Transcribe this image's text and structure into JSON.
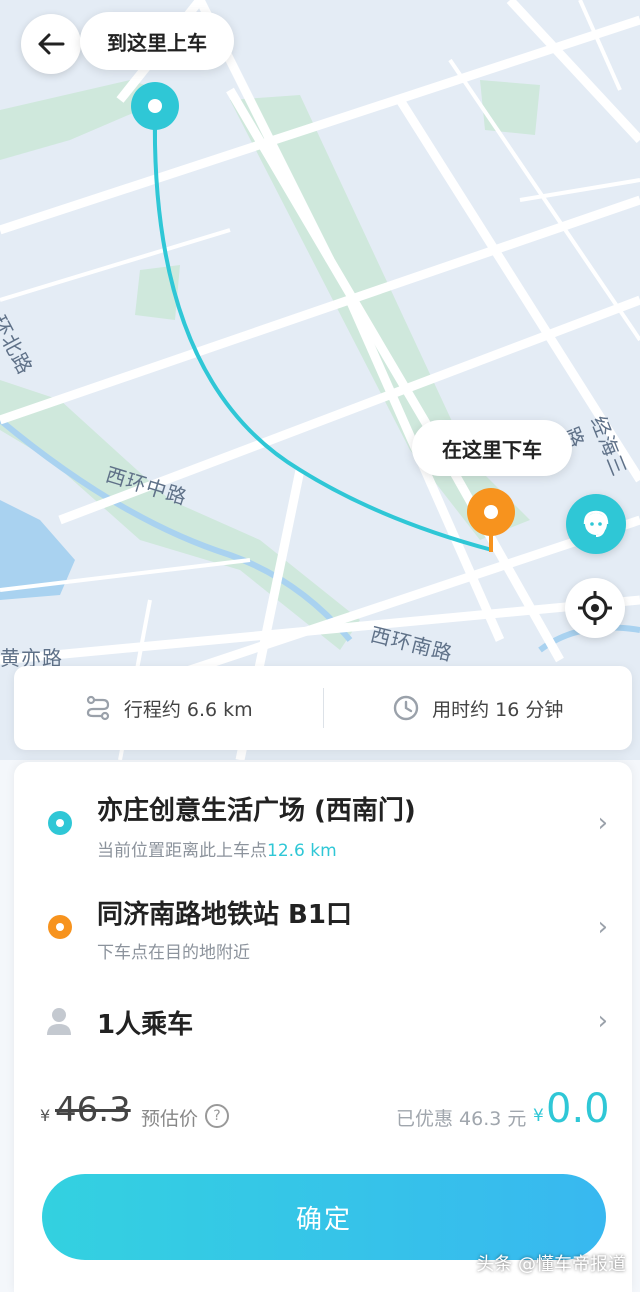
{
  "map": {
    "road_labels": [
      "西环中路",
      "西环南路",
      "经海三路",
      "环北路",
      "黄亦路"
    ],
    "pickup_bubble": "到这里上车",
    "dropoff_bubble": "在这里下车",
    "route_color": "#2fc7d6",
    "pickup_color": "#2fc7d6",
    "dropoff_color": "#f7931e"
  },
  "header": {
    "back_icon": "arrow-left-icon"
  },
  "trip_info": {
    "distance": "行程约 6.6 km",
    "duration": "用时约 16 分钟"
  },
  "pickup": {
    "title": "亦庄创意生活广场 (西南门)",
    "subtitle_prefix": "当前位置距离此上车点",
    "subtitle_distance": "12.6 km"
  },
  "dropoff": {
    "title": "同济南路地铁站 B1口",
    "subtitle": "下车点在目的地附近"
  },
  "passengers": {
    "label": "1人乘车"
  },
  "price": {
    "currency": "¥",
    "original": "46.3",
    "estimate_label": "预估价",
    "discount_text": "已优惠 46.3 元",
    "final_currency": "¥",
    "final": "0.0"
  },
  "confirm_button": "确定",
  "watermark": "头条 @懂车帝报道"
}
